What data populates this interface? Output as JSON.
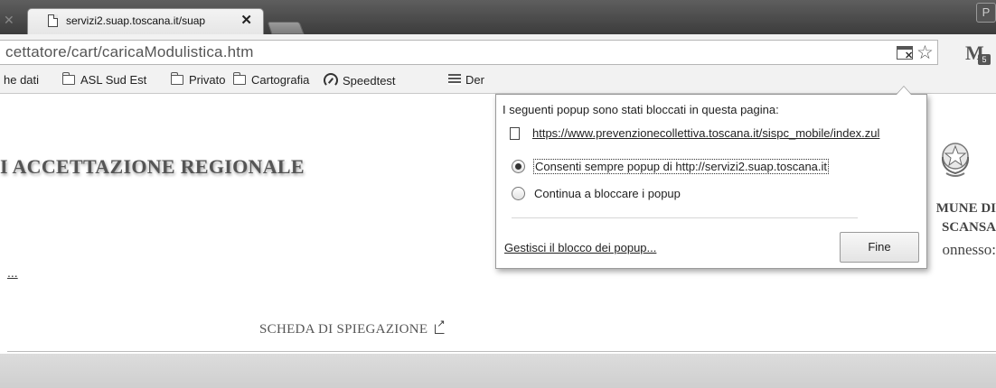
{
  "browser": {
    "tab": {
      "title": "servizi2.suap.toscana.it/suap",
      "close_glyph": "✕"
    },
    "left_tab_close_glyph": "✕",
    "profile_label": "P",
    "address_bar": {
      "url": "cettatore/cart/caricaModulistica.htm"
    },
    "gmail_badge_count": "5",
    "bookmarks": [
      {
        "label": "he dati",
        "icon": "none"
      },
      {
        "label": "ASL Sud Est",
        "icon": "folder-icon"
      },
      {
        "label": "Privato",
        "icon": "folder-icon"
      },
      {
        "label": "Cartografia",
        "icon": "folder-icon"
      },
      {
        "label": "Speedtest",
        "icon": "gauge-icon"
      },
      {
        "label": "Der",
        "icon": "stack-icon"
      }
    ]
  },
  "popup_blocker": {
    "message": "I seguenti popup sono stati bloccati in questa pagina:",
    "blocked_url": "https://www.prevenzionecollettiva.toscana.it/sispc_mobile/index.zul",
    "options": [
      {
        "label": "Consenti sempre popup di http://servizi2.suap.toscana.it",
        "selected": true
      },
      {
        "label": "Continua a bloccare i popup",
        "selected": false
      }
    ],
    "manage_link": "Gestisci il blocco dei popup...",
    "done_button": "Fine"
  },
  "page": {
    "title": "I ACCETTAZIONE REGIONALE",
    "comune_line1": "MUNE DI",
    "comune_line2": "SCANSA",
    "connesso": "onnesso:",
    "ellipsis_link": "...",
    "scheda_link": "SCHEDA DI SPIEGAZIONE"
  },
  "colors": {
    "tabstrip": "#4a4a4a",
    "toolbar": "#f2f2f2",
    "graybar": "#d6d6d6"
  }
}
